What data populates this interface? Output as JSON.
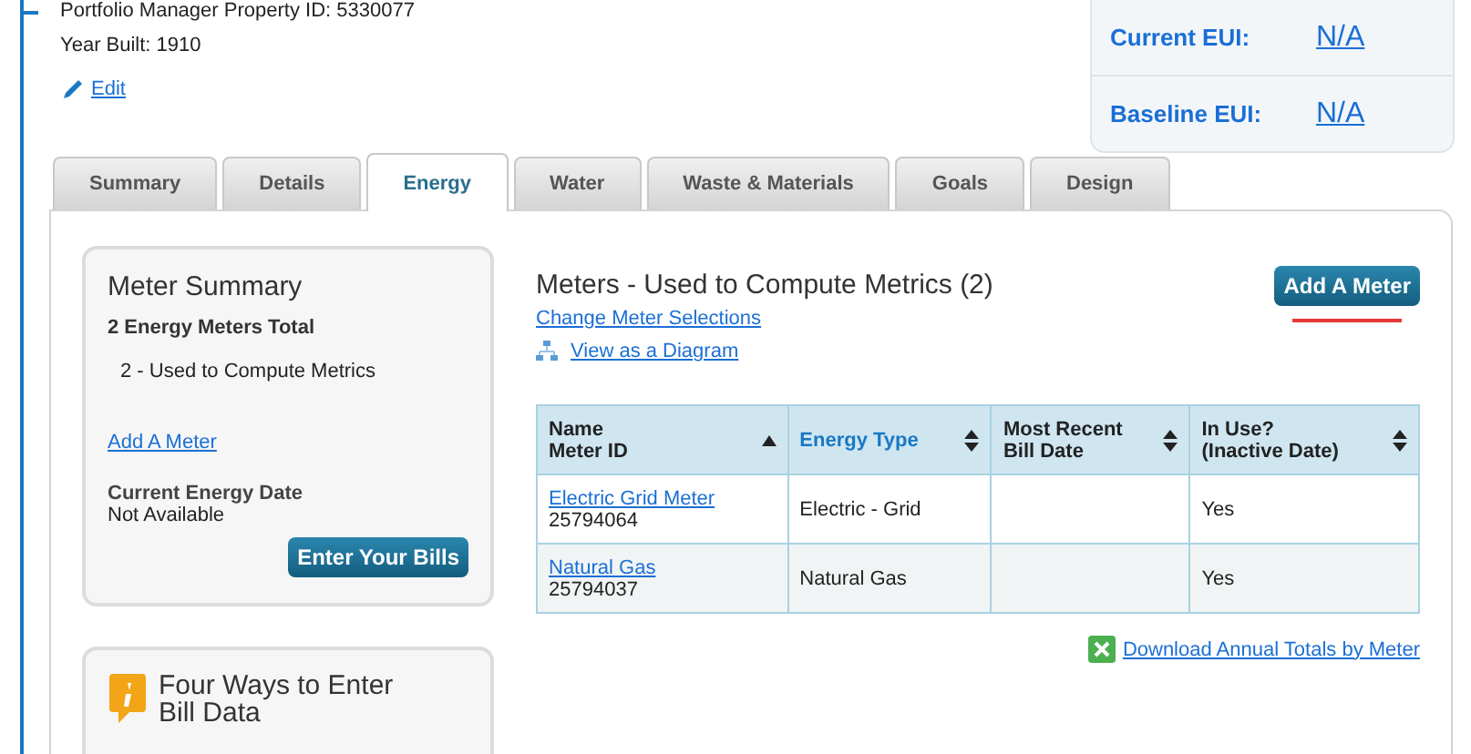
{
  "property": {
    "id_line": "Portfolio Manager Property ID: 5330077",
    "year_built": "Year Built: 1910",
    "edit_link": "Edit"
  },
  "eui": [
    {
      "label": "Current EUI:",
      "value": "N/A"
    },
    {
      "label": "Baseline EUI:",
      "value": "N/A"
    }
  ],
  "tabs": [
    {
      "label": "Summary",
      "selected": false
    },
    {
      "label": "Details",
      "selected": false
    },
    {
      "label": "Energy",
      "selected": true
    },
    {
      "label": "Water",
      "selected": false
    },
    {
      "label": "Waste & Materials",
      "selected": false
    },
    {
      "label": "Goals",
      "selected": false
    },
    {
      "label": "Design",
      "selected": false
    }
  ],
  "meter_summary": {
    "title": "Meter Summary",
    "total": "2 Energy Meters Total",
    "used": "2 - Used to Compute Metrics",
    "add_link": "Add A Meter",
    "date_label": "Current Energy Date",
    "date_value": "Not Available",
    "button": "Enter Your Bills"
  },
  "info_card": {
    "title": "Four Ways to Enter Bill Data"
  },
  "meters": {
    "title": "Meters - Used to Compute Metrics (2)",
    "add_button": "Add A Meter",
    "change_link": "Change Meter Selections",
    "diagram_link": "View as a Diagram",
    "download_link": "Download Annual Totals by Meter"
  },
  "table": {
    "columns": [
      {
        "lines": [
          "Name",
          "Meter ID"
        ],
        "sorted": true,
        "highlighted": false
      },
      {
        "lines": [
          "Energy Type"
        ],
        "sorted": false,
        "highlighted": true
      },
      {
        "lines": [
          "Most Recent",
          "Bill Date"
        ],
        "sorted": false,
        "highlighted": false
      },
      {
        "lines": [
          "In Use?",
          "(Inactive Date)"
        ],
        "sorted": false,
        "highlighted": false
      }
    ],
    "rows": [
      {
        "name": "Electric Grid Meter",
        "meter_id": "25794064",
        "energy_type": "Electric - Grid",
        "in_use": "Yes"
      },
      {
        "name": "Natural Gas",
        "meter_id": "25794037",
        "energy_type": "Natural Gas",
        "in_use": "Yes"
      }
    ]
  }
}
